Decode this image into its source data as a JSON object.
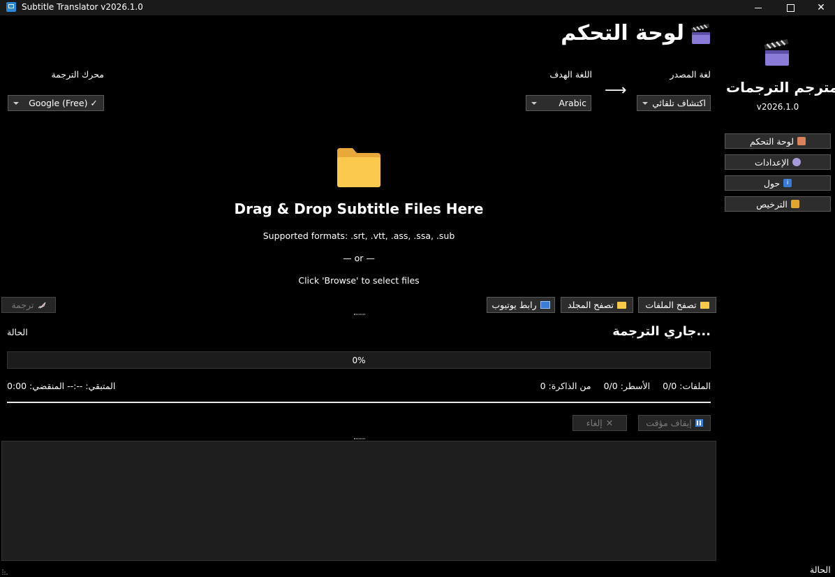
{
  "window": {
    "title": "Subtitle Translator v2026.1.0"
  },
  "sidebar": {
    "app_name": "مترجم الترجمات",
    "version": "v2026.1.0",
    "nav": [
      {
        "label": "لوحة التحكم",
        "icon": "house-icon"
      },
      {
        "label": "الإعدادات",
        "icon": "gear-icon"
      },
      {
        "label": "حول",
        "icon": "info-icon"
      },
      {
        "label": "الترخيص",
        "icon": "lock-icon"
      }
    ]
  },
  "header": {
    "title": "لوحة التحكم"
  },
  "language": {
    "source_label": "لغة المصدر",
    "source_value": "اكتشاف تلقائي",
    "target_label": "اللغة الهدف",
    "target_value": "Arabic",
    "arrow": "⟶",
    "engine_label": "محرك الترجمة",
    "engine_value": "Google (Free) ✓"
  },
  "dropzone": {
    "title": "Drag & Drop Subtitle Files Here",
    "formats": "Supported formats: .srt, .vtt, .ass, .ssa, .sub",
    "or": "— or —",
    "hint": "Click 'Browse' to select files"
  },
  "buttons": {
    "browse_files": "تصفح الملفات",
    "browse_folder": "تصفح المجلد",
    "youtube": "رابط يوتيوب",
    "translate": "ترجمة",
    "pause": "إيقاف مؤقت",
    "cancel": "إلغاء"
  },
  "status": {
    "heading": "جاري الترجمة...",
    "label": "الحالة",
    "progress_percent": 0,
    "progress_text": "0%",
    "files": "الملفات: 0/0",
    "lines": "الأسطر: 0/0",
    "memory": "من الذاكرة: 0",
    "elapsed": "المنقضي: 0:00",
    "remaining": "المتبقي: --:--"
  },
  "footer": {
    "status": "الحالة"
  },
  "colors": {
    "background": "#000000",
    "button_bg": "#2d2d2d",
    "accent": "#2b88d8",
    "folder": "#f7c948"
  }
}
